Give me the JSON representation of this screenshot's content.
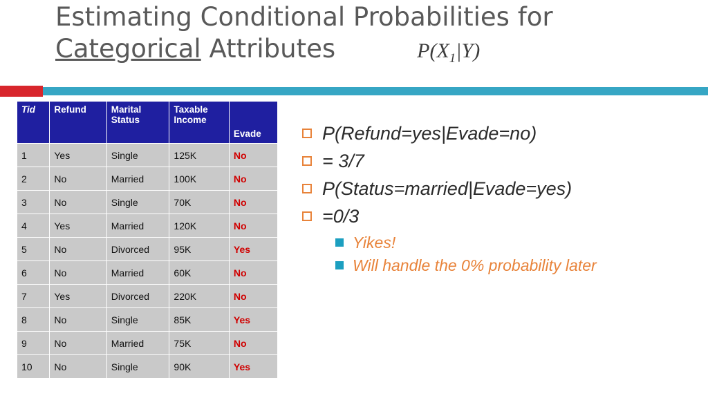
{
  "slide": {
    "title_line1": "Estimating Conditional Probabilities for",
    "title_line2_underlined": "Categorical",
    "title_line2_rest": " Attributes",
    "title_formula": {
      "p": "P",
      "open": "(",
      "x": "X",
      "sub": "1",
      "bar": "|",
      "y": "Y",
      "close": ")"
    },
    "colors": {
      "accent_red": "#d8262c",
      "accent_blue": "#36a6c4",
      "header_navy": "#1f1fa0",
      "cell_gray": "#c9c9c9",
      "value_red": "#d00000",
      "bullet_orange": "#e8833a",
      "sub_bullet_teal": "#1c9fc0",
      "title_gray": "#595959"
    }
  },
  "table": {
    "headers": [
      "Tid",
      "Refund",
      "Marital Status",
      "Taxable Income",
      "Evade"
    ],
    "header_lines": {
      "tid": "Tid",
      "refund": "Refund",
      "marital_1": "Marital",
      "marital_2": "Status",
      "income_1": "Taxable",
      "income_2": "Income",
      "evade": "Evade"
    },
    "rows": [
      {
        "tid": "1",
        "refund": "Yes",
        "marital": "Single",
        "income": "125K",
        "evade": "No"
      },
      {
        "tid": "2",
        "refund": "No",
        "marital": "Married",
        "income": "100K",
        "evade": "No"
      },
      {
        "tid": "3",
        "refund": "No",
        "marital": "Single",
        "income": "70K",
        "evade": "No"
      },
      {
        "tid": "4",
        "refund": "Yes",
        "marital": "Married",
        "income": "120K",
        "evade": "No"
      },
      {
        "tid": "5",
        "refund": "No",
        "marital": "Divorced",
        "income": "95K",
        "evade": "Yes"
      },
      {
        "tid": "6",
        "refund": "No",
        "marital": "Married",
        "income": "60K",
        "evade": "No"
      },
      {
        "tid": "7",
        "refund": "Yes",
        "marital": "Divorced",
        "income": "220K",
        "evade": "No"
      },
      {
        "tid": "8",
        "refund": "No",
        "marital": "Single",
        "income": "85K",
        "evade": "Yes"
      },
      {
        "tid": "9",
        "refund": "No",
        "marital": "Married",
        "income": "75K",
        "evade": "No"
      },
      {
        "tid": "10",
        "refund": "No",
        "marital": "Single",
        "income": "90K",
        "evade": "Yes"
      }
    ]
  },
  "bullets": [
    {
      "text": "P(Refund=yes|Evade=no)"
    },
    {
      "text": "=  3/7"
    },
    {
      "text": "P(Status=married|Evade=yes)"
    },
    {
      "text": "=0/3"
    }
  ],
  "sub_bullets": [
    {
      "text": "Yikes!"
    },
    {
      "text": "Will handle the 0% probability later"
    }
  ]
}
